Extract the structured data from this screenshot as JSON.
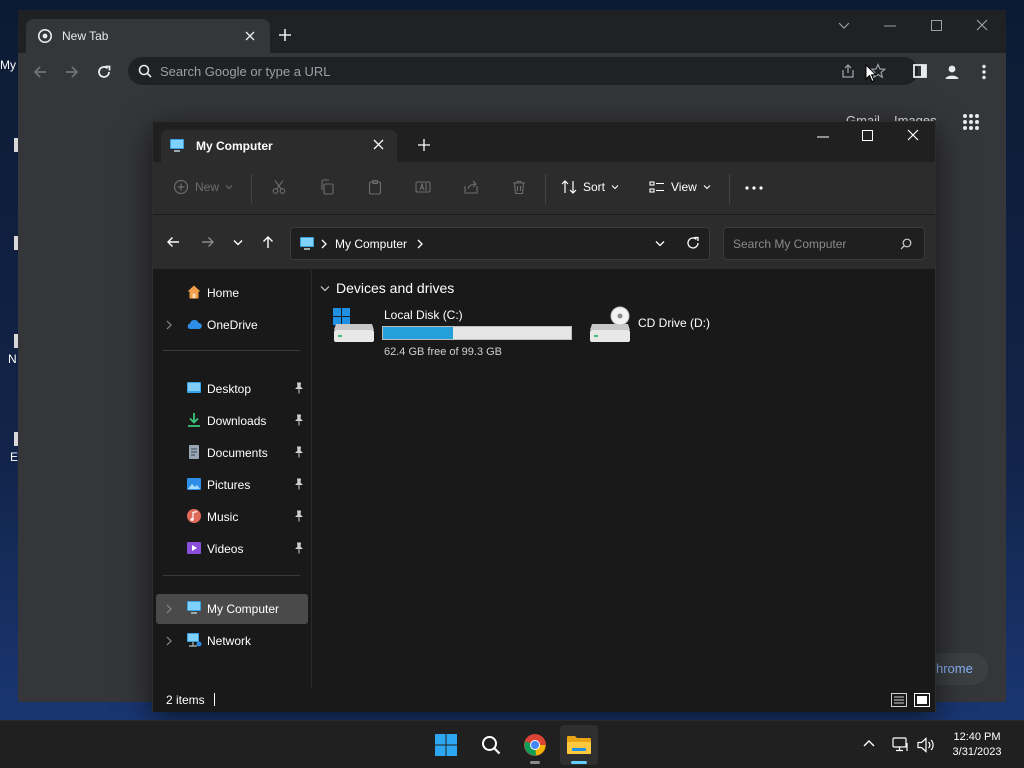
{
  "desktop": {
    "label_fragments": [
      "My",
      "N",
      "E"
    ]
  },
  "chrome": {
    "tab_title": "New Tab",
    "omnibox_placeholder": "Search Google or type a URL",
    "page_links": {
      "gmail": "Gmail",
      "images": "Images"
    },
    "customize_label": "Customize Chrome",
    "customize_visible_fragment": "hrome"
  },
  "explorer": {
    "tab_title": "My Computer",
    "commands": {
      "new": "New",
      "sort": "Sort",
      "view": "View"
    },
    "address": {
      "segments": [
        "My Computer"
      ]
    },
    "search_placeholder": "Search My Computer",
    "nav": {
      "home": "Home",
      "onedrive": "OneDrive",
      "desktop": "Desktop",
      "downloads": "Downloads",
      "documents": "Documents",
      "pictures": "Pictures",
      "music": "Music",
      "videos": "Videos",
      "my_computer": "My Computer",
      "network": "Network"
    },
    "group_header": "Devices and drives",
    "drives": [
      {
        "name": "Local Disk (C:)",
        "free_text": "62.4 GB free of 99.3 GB",
        "used_fraction": 0.372
      },
      {
        "name": "CD Drive (D:)"
      }
    ],
    "status": {
      "item_count": "2 items"
    }
  },
  "taskbar": {
    "time": "12:40 PM",
    "date": "3/31/2023"
  },
  "colors": {
    "accent": "#60cdff",
    "usage_fill": "#26a0da",
    "explorer_bg": "#191919",
    "chrome_bg": "#35363a"
  }
}
